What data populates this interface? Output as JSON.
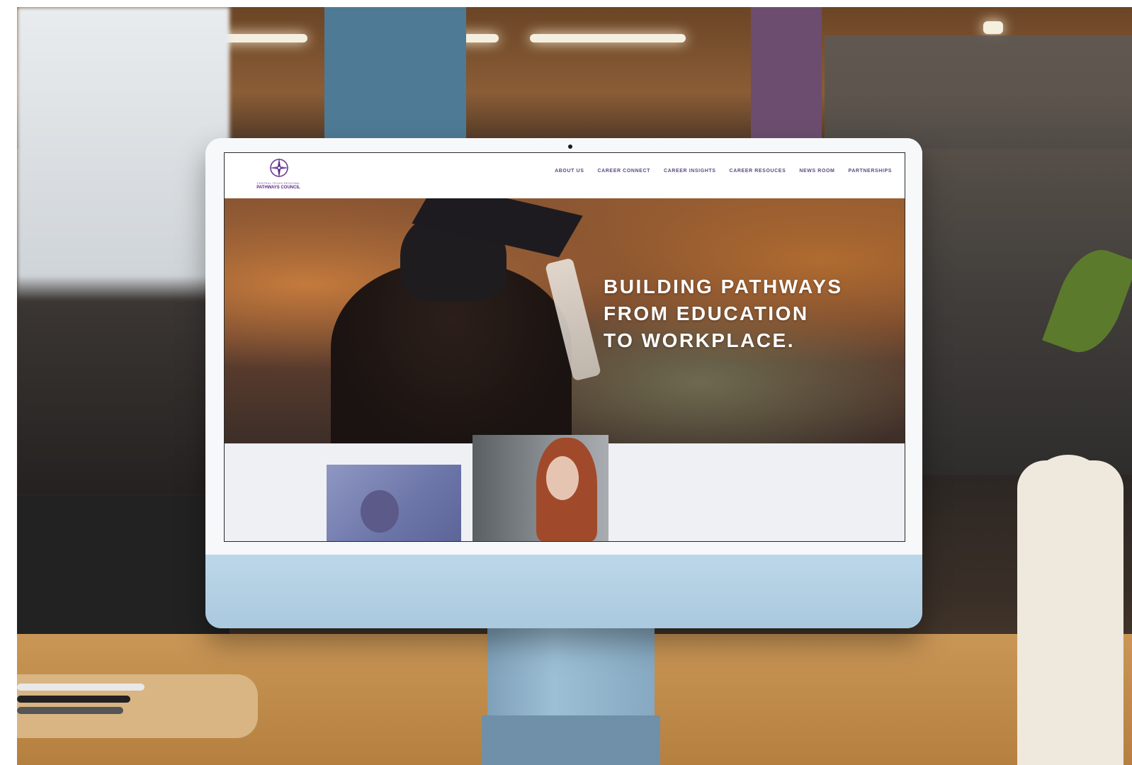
{
  "site": {
    "logo": {
      "tagline": "CENTRAL TEXAS REGIONAL",
      "name": "PATHWAYS COUNCIL"
    },
    "nav": [
      {
        "label": "ABOUT US"
      },
      {
        "label": "CAREER CONNECT"
      },
      {
        "label": "CAREER INSIGHTS"
      },
      {
        "label": "CAREER RESOUCES"
      },
      {
        "label": "NEWS ROOM"
      },
      {
        "label": "PARTNERSHIPS"
      }
    ],
    "hero": {
      "line1": "BUILDING PATHWAYS",
      "line2": "FROM EDUCATION",
      "line3": "TO WORKPLACE."
    }
  },
  "colors": {
    "brand_purple": "#5b2a86",
    "nav_text": "#5c4a82",
    "hero_text": "#ffffff",
    "imac_body": "#b9d6e8"
  }
}
